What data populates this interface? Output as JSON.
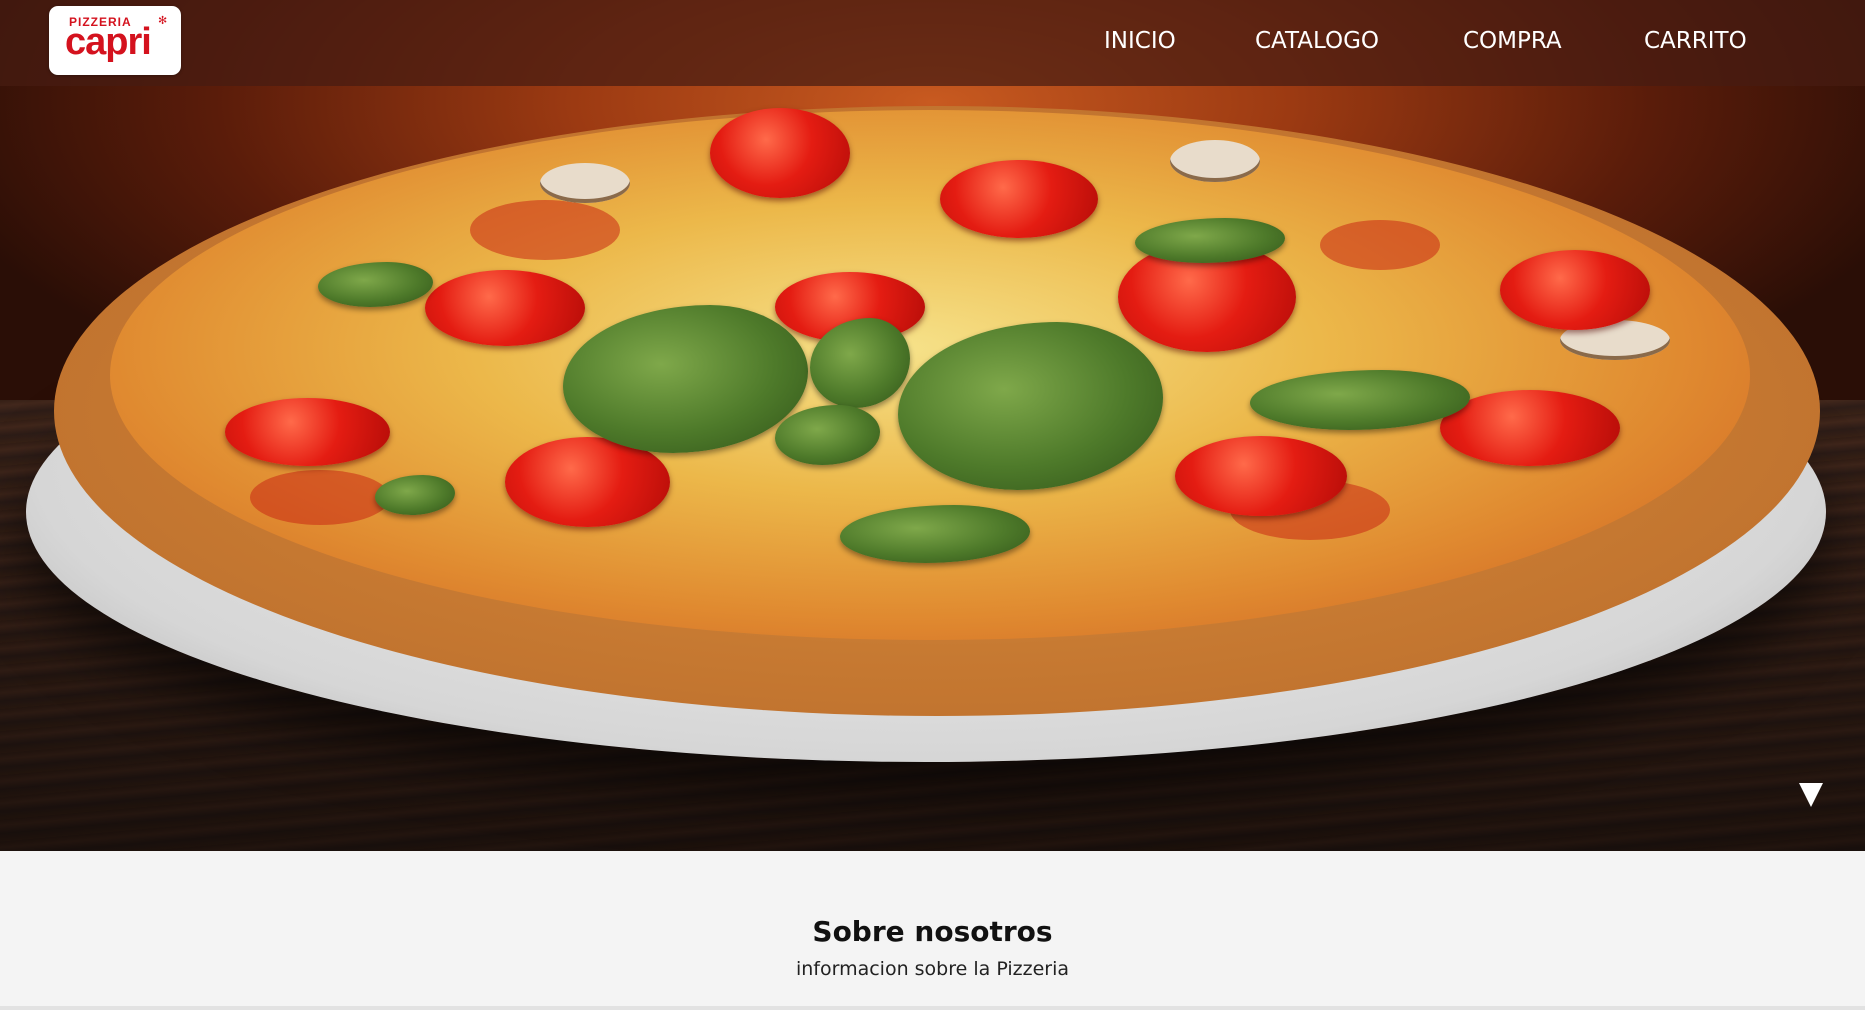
{
  "brand": {
    "small_text": "PIZZERIA",
    "name": "capri",
    "color": "#d4121e"
  },
  "nav": {
    "items": [
      {
        "label": "INICIO"
      },
      {
        "label": "CATALOGO"
      },
      {
        "label": "COMPRA"
      },
      {
        "label": "CARRITO"
      }
    ]
  },
  "hero": {
    "image": "pizza-photo",
    "scroll_icon": "triangle-down-icon"
  },
  "about": {
    "title": "Sobre nosotros",
    "subtitle": "informacion sobre la Pizzeria"
  }
}
